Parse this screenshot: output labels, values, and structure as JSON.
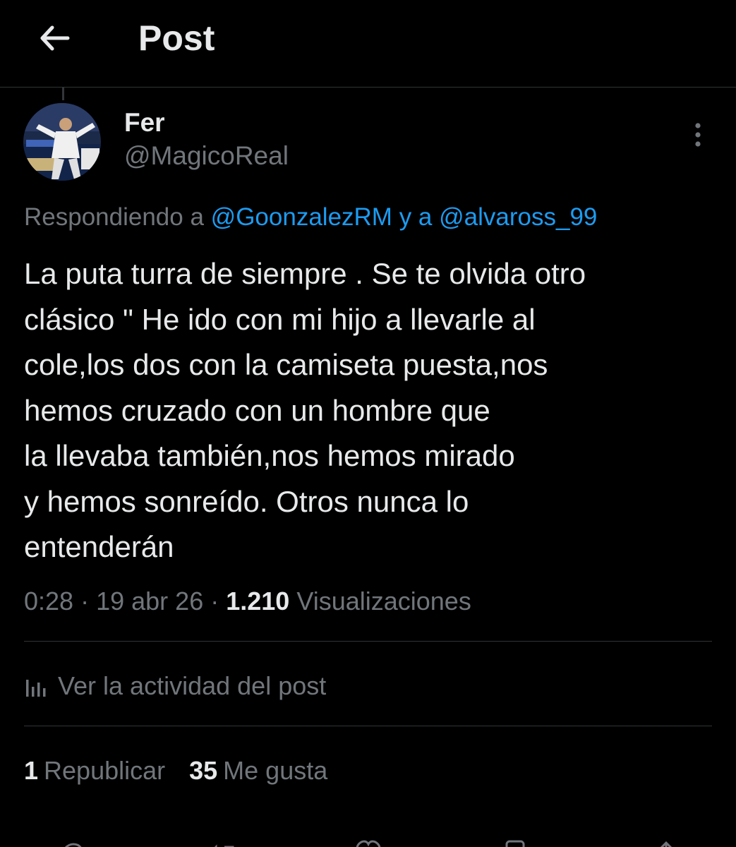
{
  "header": {
    "title": "Post",
    "back_icon": "arrow-left-icon"
  },
  "post": {
    "author": {
      "display_name": "Fer",
      "handle": "@MagicoReal"
    },
    "more_icon": "more-vertical-icon",
    "replying": {
      "prefix": "Respondiendo a",
      "mention_1": "@GoonzalezRM",
      "joiner": "y a",
      "mention_2": "@alvaross_99"
    },
    "text_lines": [
      "La puta turra de siempre . Se te olvida otro",
      "clásico \" He ido con mi hijo a llevarle al",
      "cole,los dos con la camiseta puesta,nos",
      "hemos cruzado con un hombre que",
      "la llevaba también,nos hemos mirado",
      "y hemos sonreído. Otros nunca lo",
      "entenderán"
    ],
    "meta": {
      "time": "0:28",
      "date": "19 abr 26",
      "views_count": "1.210",
      "views_label": "Visualizaciones"
    },
    "activity": {
      "icon": "analytics-icon",
      "label": "Ver la actividad del post"
    },
    "stats": {
      "reposts_count": "1",
      "reposts_label": "Republicar",
      "likes_count": "35",
      "likes_label": "Me gusta"
    },
    "actions": [
      "reply-icon",
      "repost-icon",
      "like-icon",
      "bookmark-icon",
      "share-icon"
    ]
  },
  "colors": {
    "background": "#000000",
    "text_primary": "#e7e9ea",
    "text_secondary": "#71767b",
    "accent": "#1d9bf0",
    "divider": "#2f3336"
  }
}
